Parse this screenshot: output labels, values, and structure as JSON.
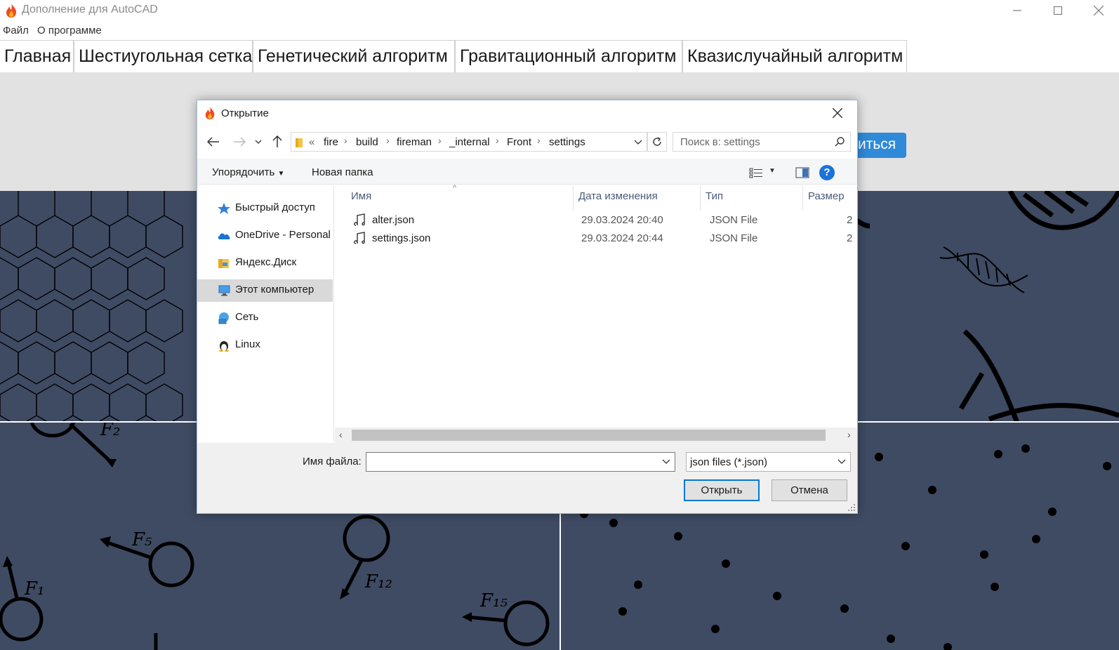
{
  "window": {
    "title": "Дополнение для AutoCAD",
    "minimize_icon": "minimize-icon",
    "maximize_icon": "maximize-icon",
    "close_icon": "close-icon"
  },
  "menubar": {
    "items": [
      {
        "label": "Файл"
      },
      {
        "label": "О программе"
      }
    ]
  },
  "tabs": [
    {
      "label": "Главная"
    },
    {
      "label": "Шестиугольная сетка"
    },
    {
      "label": "Генетический алгоритм"
    },
    {
      "label": "Гравитационный алгоритм"
    },
    {
      "label": "Квазислучайный алгоритм"
    }
  ],
  "background_button": {
    "label": "иться"
  },
  "background_panels": {
    "hexagon": {
      "icon": "hexagon-grid"
    },
    "genetic": {
      "icon": "dna-helix"
    },
    "gravity": {
      "labels": [
        "F₂",
        "F₅",
        "F₁",
        "F₁₂",
        "F₁₅"
      ]
    },
    "quasi": {
      "icon": "scatter-dots"
    }
  },
  "dialog": {
    "title": "Открытие",
    "address": {
      "prefix": "«",
      "crumbs": [
        "fire",
        "build",
        "fireman",
        "_internal",
        "Front",
        "settings"
      ]
    },
    "search_placeholder": "Поиск в: settings",
    "commands": {
      "organize": "Упорядочить",
      "new_folder": "Новая папка"
    },
    "nav_items": [
      {
        "label": "Быстрый доступ",
        "icon": "star-icon"
      },
      {
        "label": "OneDrive - Personal",
        "icon": "cloud-icon"
      },
      {
        "label": "Яндекс.Диск",
        "icon": "folder-icon"
      },
      {
        "label": "Этот компьютер",
        "icon": "computer-icon",
        "selected": true
      },
      {
        "label": "Сеть",
        "icon": "network-icon"
      },
      {
        "label": "Linux",
        "icon": "linux-icon"
      }
    ],
    "columns": {
      "name": "Имя",
      "date": "Дата изменения",
      "type": "Тип",
      "size": "Размер"
    },
    "files": [
      {
        "name": "alter.json",
        "date": "29.03.2024 20:40",
        "type": "JSON File",
        "size": "2"
      },
      {
        "name": "settings.json",
        "date": "29.03.2024 20:44",
        "type": "JSON File",
        "size": "2"
      }
    ],
    "filename_label": "Имя файла:",
    "filename_value": "",
    "filetype": "json files (*.json)",
    "open_button": "Открыть",
    "cancel_button": "Отмена"
  }
}
